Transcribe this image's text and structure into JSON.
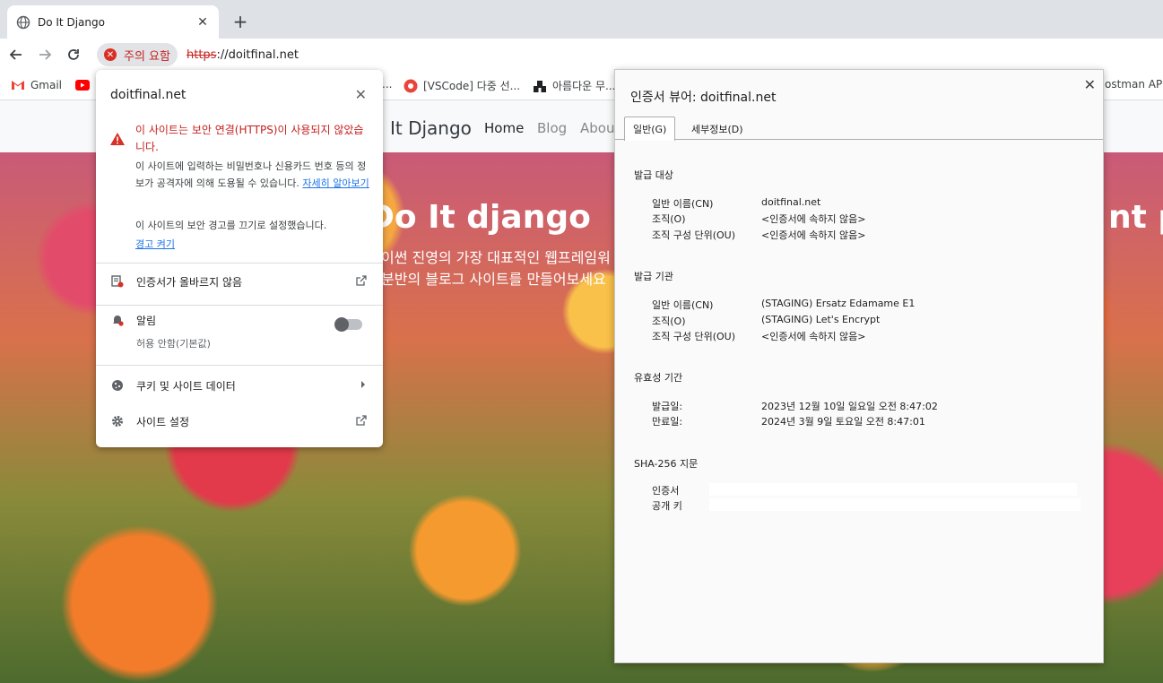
{
  "tab": {
    "title": "Do It Django",
    "close": "✕"
  },
  "newtab": "+",
  "toolbar": {
    "chip_text": "주의 요함",
    "url_scheme": "https",
    "url_rest": "://doitfinal.net"
  },
  "bookmarks": [
    {
      "label": "Gmail",
      "icon": "gmail-icon"
    },
    {
      "label": "",
      "icon": "youtube-icon"
    },
    {
      "label": "...",
      "icon": ""
    },
    {
      "label": "[VSCode] 다중 선...",
      "icon": "vscode-bookmark-icon"
    },
    {
      "label": "아름다운 무...",
      "icon": "bookmark-icon"
    },
    {
      "label": "ostman API P",
      "icon": ""
    }
  ],
  "site": {
    "brand": "It Django",
    "nav": [
      "Home",
      "Blog",
      "Abou"
    ],
    "hero_title": "Do It django",
    "hero_sub1": "이썬 진영의 가장 대표적인 웹프레임워",
    "hero_sub2": "분반의 블로그 사이트를 만들어보세요",
    "hero_right": "nt po"
  },
  "siteinfo": {
    "domain": "doitfinal.net",
    "close": "✕",
    "warn_title": "이 사이트는 보안 연결(HTTPS)이 사용되지 않았습니다.",
    "warn_body": "이 사이트에 입력하는 비밀번호나 신용카드 번호 등의 정보가 공격자에 의해 도용될 수 있습니다.",
    "learn_more": "자세히 알아보기",
    "disabled_notice": "이 사이트의 보안 경고를 끄기로 설정했습니다.",
    "enable_link": "경고 켜기",
    "cert_row": "인증서가 올바르지 않음",
    "notif_label": "알림",
    "notif_sub": "허용 안함(기본값)",
    "cookies_row": "쿠키 및 사이트 데이터",
    "settings_row": "사이트 설정"
  },
  "cert": {
    "title": "인증서 뷰어: doitfinal.net",
    "close": "✕",
    "tab_general": "일반(G)",
    "tab_details": "세부정보(D)",
    "issued_to": {
      "title": "발급 대상",
      "rows": [
        {
          "k": "일반 이름(CN)",
          "v": "doitfinal.net"
        },
        {
          "k": "조직(O)",
          "v": "<인증서에 속하지 않음>"
        },
        {
          "k": "조직 구성 단위(OU)",
          "v": "<인증서에 속하지 않음>"
        }
      ]
    },
    "issued_by": {
      "title": "발급 기관",
      "rows": [
        {
          "k": "일반 이름(CN)",
          "v": "(STAGING) Ersatz Edamame E1"
        },
        {
          "k": "조직(O)",
          "v": "(STAGING) Let's Encrypt"
        },
        {
          "k": "조직 구성 단위(OU)",
          "v": "<인증서에 속하지 않음>"
        }
      ]
    },
    "validity": {
      "title": "유효성 기간",
      "rows": [
        {
          "k": "발급일:",
          "v": "2023년 12월 10일 일요일 오전 8:47:02"
        },
        {
          "k": "만료일:",
          "v": "2024년 3월 9일 토요일 오전 8:47:01"
        }
      ]
    },
    "fingerprint": {
      "title": "SHA-256 지문",
      "rows": [
        {
          "k": "인증서",
          "v": ""
        },
        {
          "k": "공개 키",
          "v": ""
        }
      ]
    }
  }
}
